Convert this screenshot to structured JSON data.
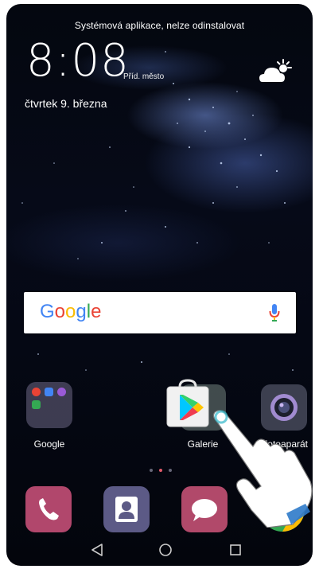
{
  "status": {
    "message": "Systémová aplikace, nelze odinstalovat"
  },
  "clock": {
    "time": "8:08",
    "caption": "Příd. město"
  },
  "date": {
    "text": "čtvrtek 9. března"
  },
  "weather": {
    "icon": "partly-cloudy-icon"
  },
  "search": {
    "logo": "Google",
    "icon": "mic-icon"
  },
  "home": {
    "apps": [
      {
        "label": "Google",
        "icon": "google-folder-icon"
      },
      {
        "label": "Galerie",
        "icon": "gallery-icon"
      },
      {
        "label": "Fotoaparát",
        "icon": "camera-icon"
      }
    ],
    "dragging": {
      "icon": "play-store-icon"
    }
  },
  "dock": [
    {
      "icon": "phone-icon"
    },
    {
      "icon": "contacts-icon"
    },
    {
      "icon": "messages-icon"
    },
    {
      "icon": "chrome-icon"
    }
  ],
  "navbar": {
    "icons": [
      "back-icon",
      "home-icon",
      "recents-icon"
    ]
  },
  "colors": {
    "google_blue": "#4285F4",
    "google_red": "#EA4335",
    "google_yellow": "#FBBC05",
    "google_green": "#34A853"
  }
}
